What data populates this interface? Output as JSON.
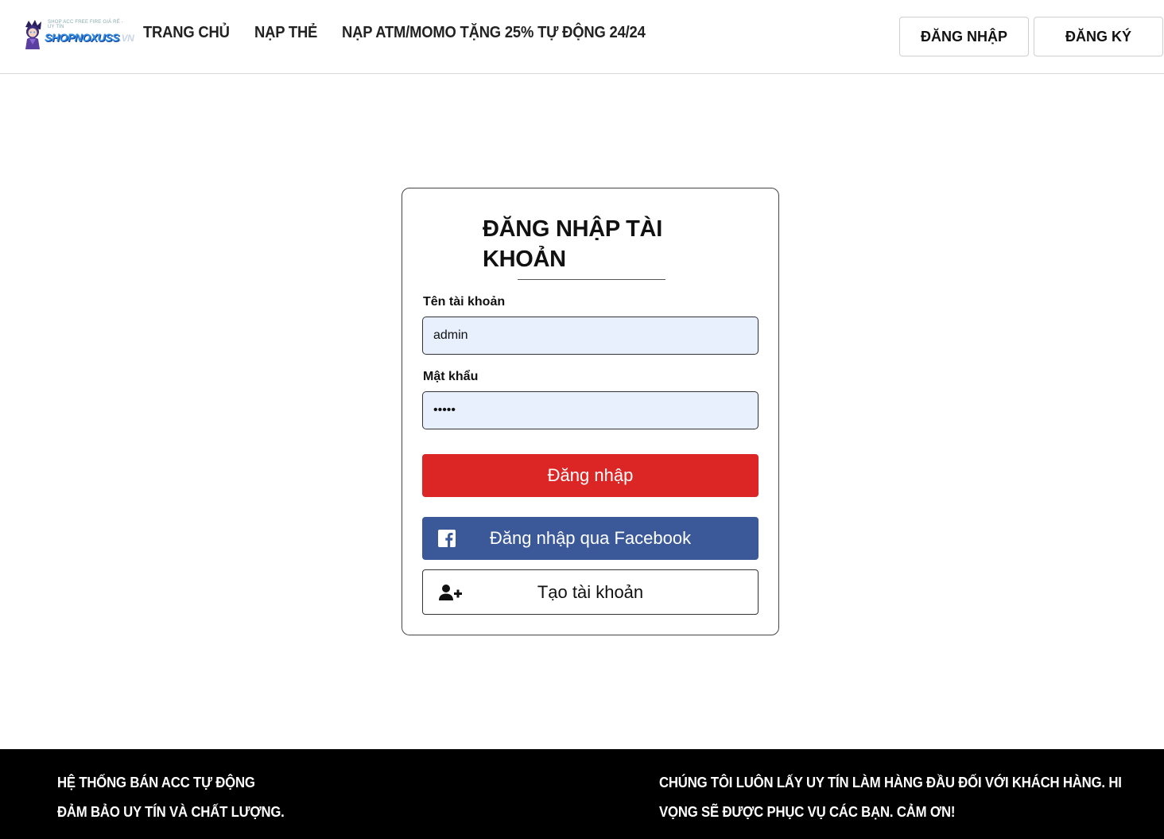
{
  "header": {
    "logo": {
      "name": "shop-logo",
      "text": "SHOPNOXUSS",
      "tld": ".VN",
      "tagline": "SHOP ACC FREE FIRE GIÁ RẺ - UY TÍN",
      "accent": "#2f8fe8"
    },
    "nav": [
      {
        "label": "TRANG CHỦ"
      },
      {
        "label": "NẠP THẺ"
      },
      {
        "label": "NẠP ATM/MOMO TẶNG 25% TỰ ĐỘNG 24/24"
      }
    ],
    "login_label": "ĐĂNG NHẬP",
    "register_label": "ĐĂNG KÝ"
  },
  "login_form": {
    "title": "ĐĂNG NHẬP TÀI KHOẢN",
    "username_label": "Tên tài khoản",
    "username_value": "admin",
    "password_label": "Mật khẩu",
    "password_value": "admin",
    "submit_label": "Đăng nhập",
    "facebook_label": "Đăng nhập qua Facebook",
    "create_label": "Tạo tài khoản",
    "colors": {
      "submit": "#dc2626",
      "facebook": "#3b5998"
    }
  },
  "footer": {
    "left_lines": [
      "HỆ THỐNG BÁN ACC TỰ ĐỘNG",
      "ĐẢM BẢO UY TÍN VÀ CHẤT LƯỢNG."
    ],
    "right_lines": [
      "CHÚNG TÔI LUÔN LẤY UY TÍN LÀM HÀNG ĐẦU ĐỐI VỚI KHÁCH HÀNG. HI",
      "VỌNG SẼ ĐƯỢC PHỤC VỤ CÁC BẠN. CẢM ƠN!"
    ]
  }
}
